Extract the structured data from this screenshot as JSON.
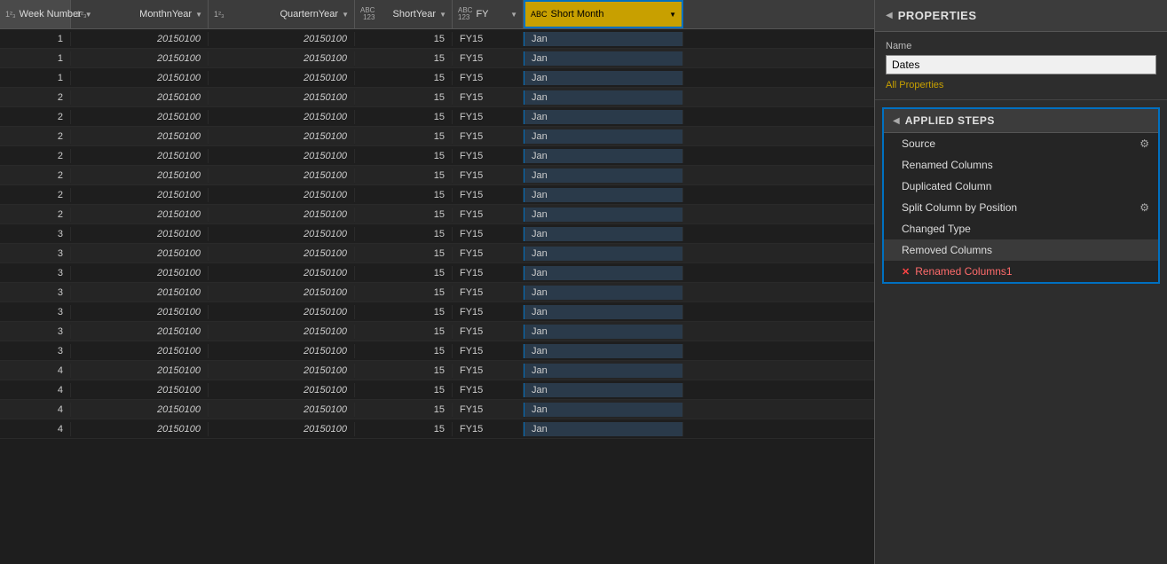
{
  "columns": [
    {
      "id": "week",
      "type": "123",
      "name": "Week Number",
      "width": "w-week"
    },
    {
      "id": "monthyear",
      "type": "123",
      "name": "MonthnYear",
      "width": "w-month-year"
    },
    {
      "id": "quarteryear",
      "type": "123",
      "name": "QuarternYear",
      "width": "w-quarter-year"
    },
    {
      "id": "shortyear",
      "type": "ABC123",
      "name": "ShortYear",
      "width": "w-short-year"
    },
    {
      "id": "fy",
      "type": "ABC",
      "name": "FY",
      "width": "w-fy"
    },
    {
      "id": "shortmonth",
      "type": "ABC",
      "name": "Short Month",
      "width": "w-short-month",
      "highlighted": true
    }
  ],
  "rows": [
    {
      "week": "1",
      "monthyear": "20150100",
      "quarteryear": "20150100",
      "shortyear": "15",
      "fy": "FY15",
      "shortmonth": "Jan"
    },
    {
      "week": "1",
      "monthyear": "20150100",
      "quarteryear": "20150100",
      "shortyear": "15",
      "fy": "FY15",
      "shortmonth": "Jan"
    },
    {
      "week": "1",
      "monthyear": "20150100",
      "quarteryear": "20150100",
      "shortyear": "15",
      "fy": "FY15",
      "shortmonth": "Jan"
    },
    {
      "week": "2",
      "monthyear": "20150100",
      "quarteryear": "20150100",
      "shortyear": "15",
      "fy": "FY15",
      "shortmonth": "Jan"
    },
    {
      "week": "2",
      "monthyear": "20150100",
      "quarteryear": "20150100",
      "shortyear": "15",
      "fy": "FY15",
      "shortmonth": "Jan"
    },
    {
      "week": "2",
      "monthyear": "20150100",
      "quarteryear": "20150100",
      "shortyear": "15",
      "fy": "FY15",
      "shortmonth": "Jan"
    },
    {
      "week": "2",
      "monthyear": "20150100",
      "quarteryear": "20150100",
      "shortyear": "15",
      "fy": "FY15",
      "shortmonth": "Jan"
    },
    {
      "week": "2",
      "monthyear": "20150100",
      "quarteryear": "20150100",
      "shortyear": "15",
      "fy": "FY15",
      "shortmonth": "Jan"
    },
    {
      "week": "2",
      "monthyear": "20150100",
      "quarteryear": "20150100",
      "shortyear": "15",
      "fy": "FY15",
      "shortmonth": "Jan"
    },
    {
      "week": "2",
      "monthyear": "20150100",
      "quarteryear": "20150100",
      "shortyear": "15",
      "fy": "FY15",
      "shortmonth": "Jan"
    },
    {
      "week": "3",
      "monthyear": "20150100",
      "quarteryear": "20150100",
      "shortyear": "15",
      "fy": "FY15",
      "shortmonth": "Jan"
    },
    {
      "week": "3",
      "monthyear": "20150100",
      "quarteryear": "20150100",
      "shortyear": "15",
      "fy": "FY15",
      "shortmonth": "Jan"
    },
    {
      "week": "3",
      "monthyear": "20150100",
      "quarteryear": "20150100",
      "shortyear": "15",
      "fy": "FY15",
      "shortmonth": "Jan"
    },
    {
      "week": "3",
      "monthyear": "20150100",
      "quarteryear": "20150100",
      "shortyear": "15",
      "fy": "FY15",
      "shortmonth": "Jan"
    },
    {
      "week": "3",
      "monthyear": "20150100",
      "quarteryear": "20150100",
      "shortyear": "15",
      "fy": "FY15",
      "shortmonth": "Jan"
    },
    {
      "week": "3",
      "monthyear": "20150100",
      "quarteryear": "20150100",
      "shortyear": "15",
      "fy": "FY15",
      "shortmonth": "Jan"
    },
    {
      "week": "3",
      "monthyear": "20150100",
      "quarteryear": "20150100",
      "shortyear": "15",
      "fy": "FY15",
      "shortmonth": "Jan"
    },
    {
      "week": "4",
      "monthyear": "20150100",
      "quarteryear": "20150100",
      "shortyear": "15",
      "fy": "FY15",
      "shortmonth": "Jan"
    },
    {
      "week": "4",
      "monthyear": "20150100",
      "quarteryear": "20150100",
      "shortyear": "15",
      "fy": "FY15",
      "shortmonth": "Jan"
    },
    {
      "week": "4",
      "monthyear": "20150100",
      "quarteryear": "20150100",
      "shortyear": "15",
      "fy": "FY15",
      "shortmonth": "Jan"
    },
    {
      "week": "4",
      "monthyear": "20150100",
      "quarteryear": "20150100",
      "shortyear": "15",
      "fy": "FY15",
      "shortmonth": "Jan"
    }
  ],
  "properties": {
    "panel_title": "PROPERTIES",
    "name_label": "Name",
    "name_value": "Dates",
    "all_properties_link": "All Properties"
  },
  "applied_steps": {
    "title": "APPLIED STEPS",
    "steps": [
      {
        "id": "source",
        "name": "Source",
        "has_gear": true,
        "active": false,
        "error": false
      },
      {
        "id": "renamed-columns",
        "name": "Renamed Columns",
        "has_gear": false,
        "active": false,
        "error": false
      },
      {
        "id": "duplicated-column",
        "name": "Duplicated Column",
        "has_gear": false,
        "active": false,
        "error": false
      },
      {
        "id": "split-column",
        "name": "Split Column by Position",
        "has_gear": true,
        "active": false,
        "error": false
      },
      {
        "id": "changed-type",
        "name": "Changed Type",
        "has_gear": false,
        "active": false,
        "error": false
      },
      {
        "id": "removed-columns",
        "name": "Removed Columns",
        "has_gear": false,
        "active": true,
        "error": false
      },
      {
        "id": "renamed-columns1",
        "name": "Renamed Columns1",
        "has_gear": false,
        "active": false,
        "error": true
      }
    ]
  }
}
